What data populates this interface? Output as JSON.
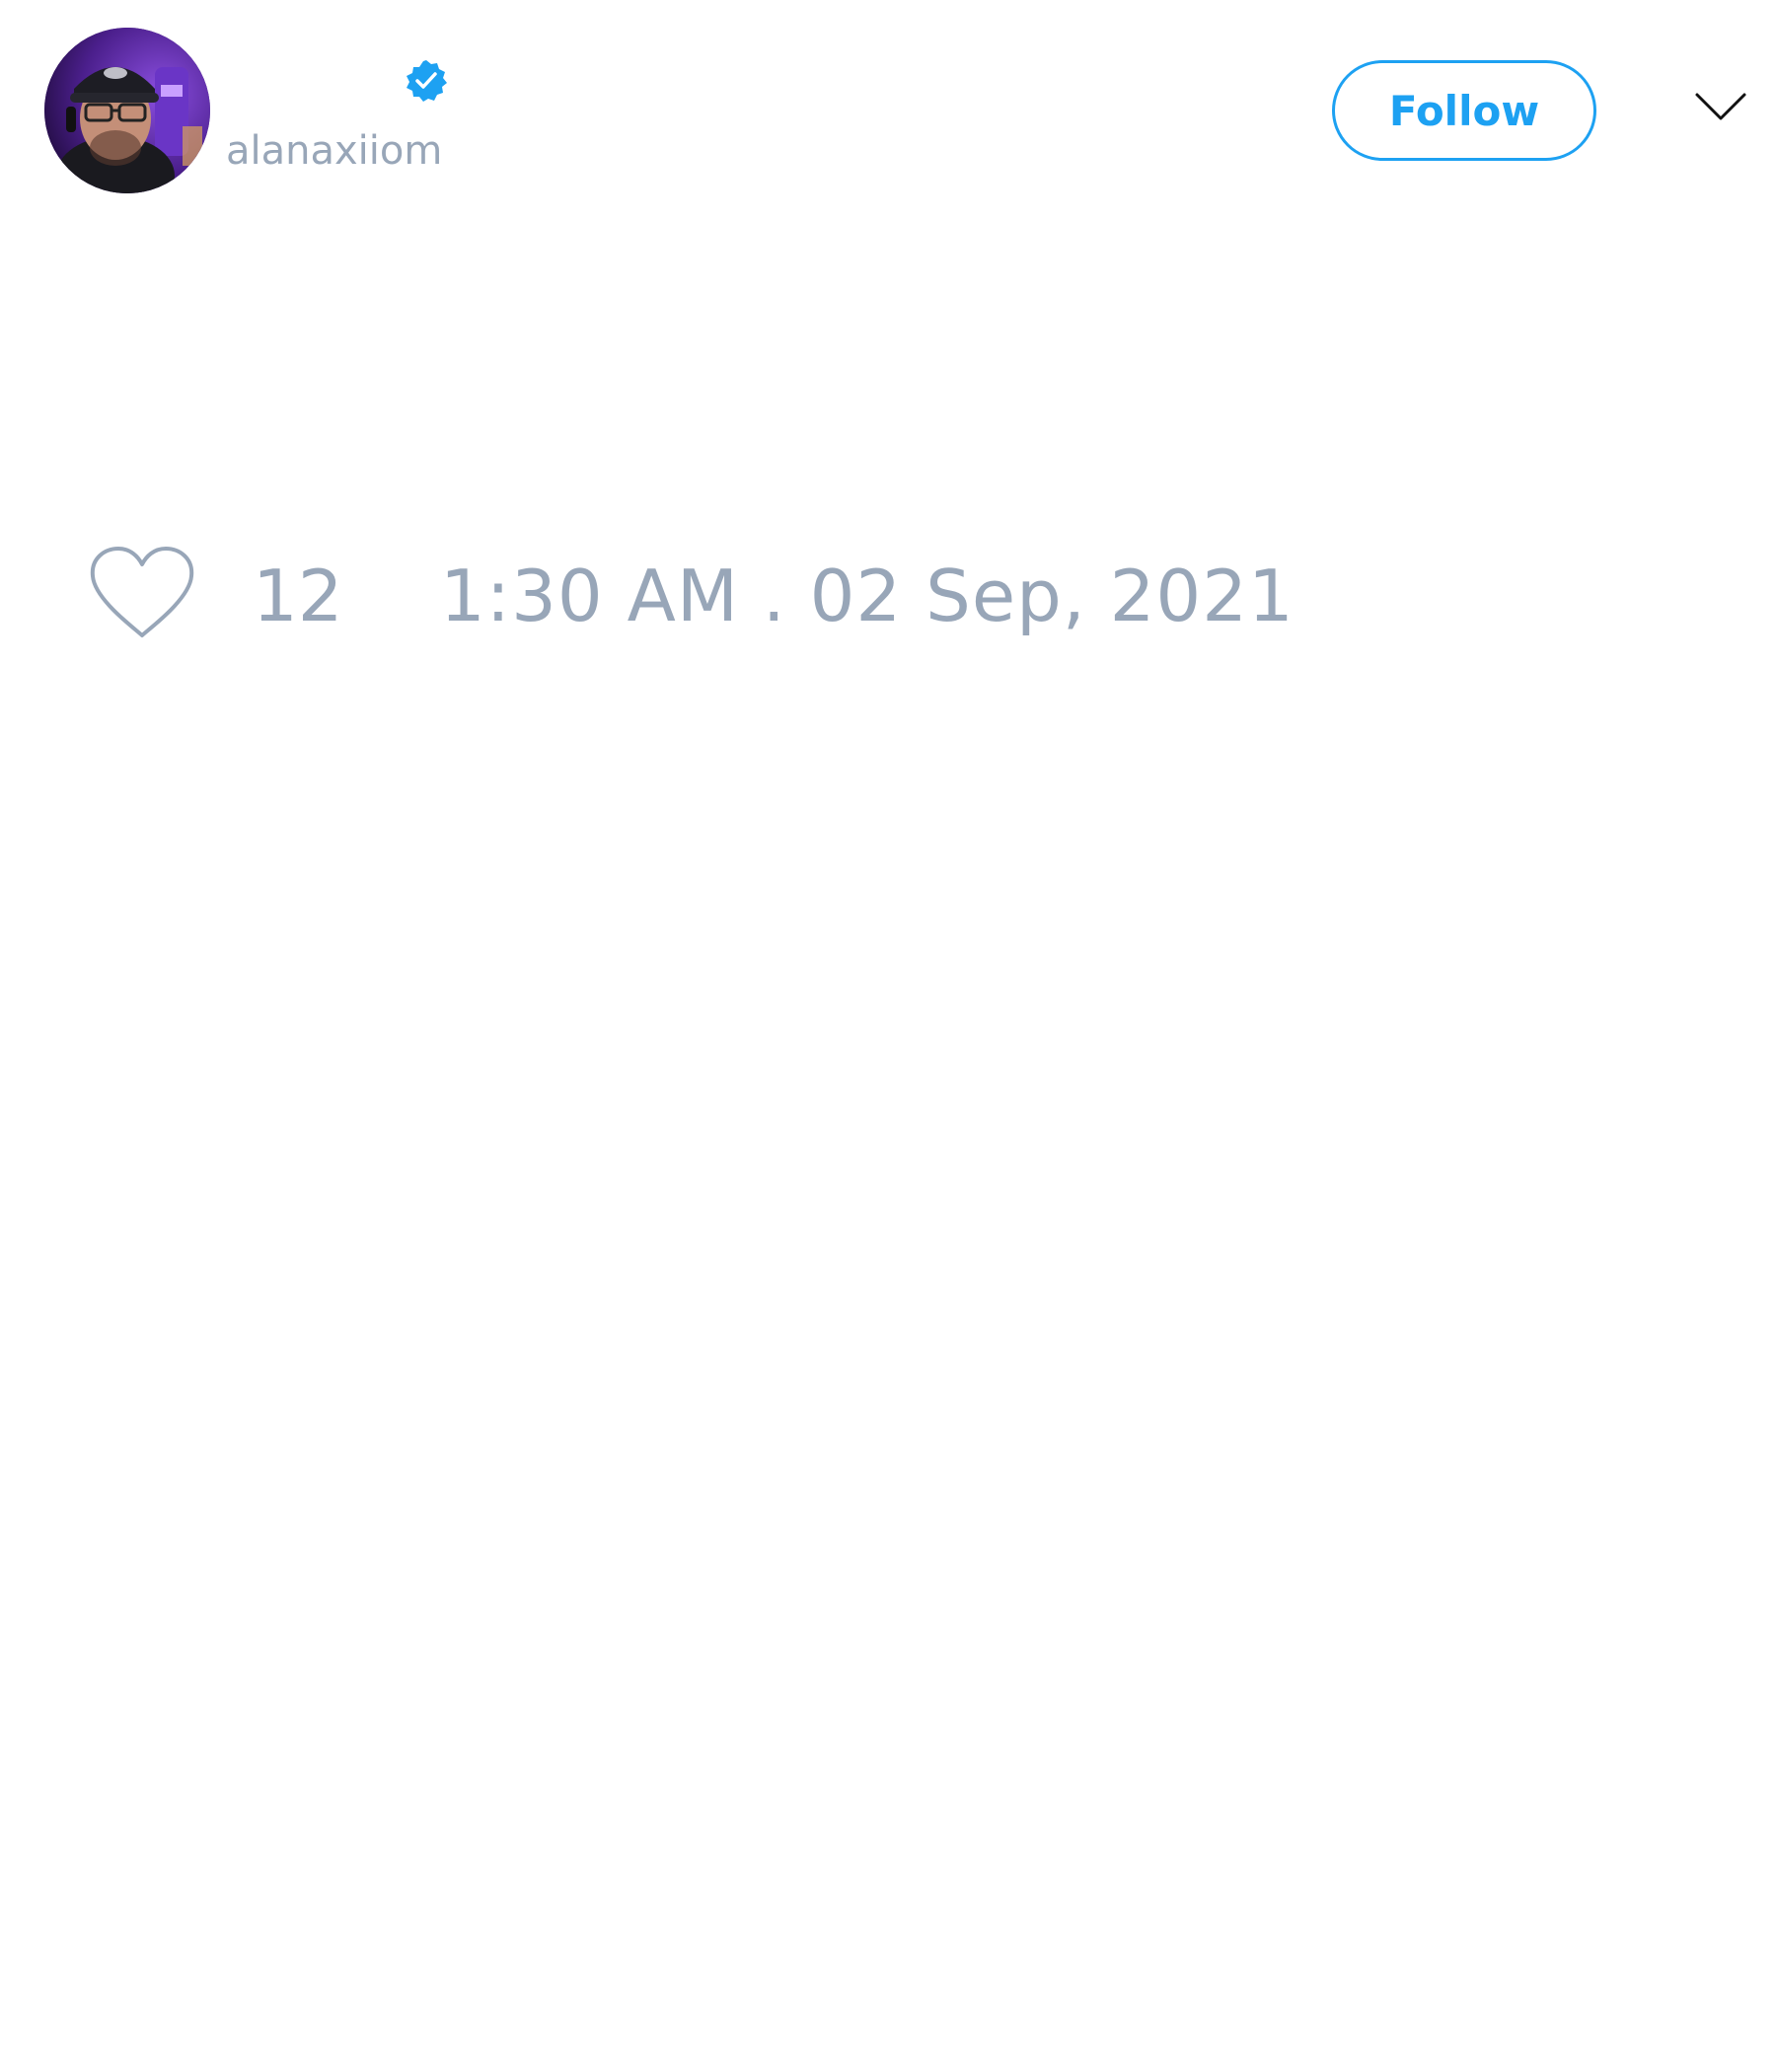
{
  "author": {
    "display_name": "",
    "handle": "alanaxiiom",
    "verified": true
  },
  "header": {
    "follow_label": "Follow",
    "more_icon": "chevron-down-icon"
  },
  "actions": {
    "like_icon": "heart-icon",
    "like_count": "12",
    "timestamp": "1:30 AM . 02 Sep, 2021"
  },
  "colors": {
    "accent": "#1da1f2",
    "muted_text": "#98a6b8",
    "background": "#ffffff"
  }
}
